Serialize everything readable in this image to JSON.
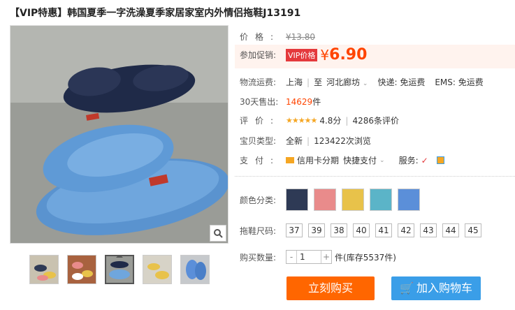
{
  "title": "【VIP特惠】韩国夏季一字洗澡夏季家居家室内外情侣拖鞋J13191",
  "price": {
    "label": "价格:",
    "value": "¥13.80"
  },
  "promo": {
    "label": "参加促销:",
    "tag": "VIP价格",
    "yen": "¥",
    "value": "6.90"
  },
  "shipping": {
    "label": "物流运费:",
    "from": "上海",
    "to_prefix": "至",
    "to": "河北廊坊",
    "express": "快递: 免运费",
    "ems": "EMS: 免运费"
  },
  "sales": {
    "label": "30天售出:",
    "count": "14629",
    "unit": "件"
  },
  "rating": {
    "label": "评价:",
    "stars": "★★★★★",
    "score": "4.8分",
    "reviews": "4286条评价"
  },
  "item": {
    "label": "宝贝类型:",
    "type": "全新",
    "views": "123422次浏览"
  },
  "payment": {
    "label": "支付:",
    "credit": "信用卡分期",
    "quick": "快捷支付",
    "service_label": "服务:"
  },
  "color": {
    "label": "颜色分类:",
    "swatches": [
      "#2e3a55",
      "#e98b8b",
      "#e8c24a",
      "#5bb4c8",
      "#5b8fd9"
    ]
  },
  "size": {
    "label": "拖鞋尺码:",
    "options": [
      "37",
      "39",
      "38",
      "40",
      "41",
      "42",
      "43",
      "44",
      "45"
    ]
  },
  "quantity": {
    "label": "购买数量:",
    "minus": "-",
    "value": "1",
    "plus": "+",
    "unit": "件",
    "stock": "(库存5537件)"
  },
  "buttons": {
    "buy": "立刻购买",
    "cart": "加入购物车"
  },
  "colors": {
    "accent": "#ff4400",
    "buy_bg": "#ff6600",
    "cart_bg": "#3a9ee8"
  }
}
